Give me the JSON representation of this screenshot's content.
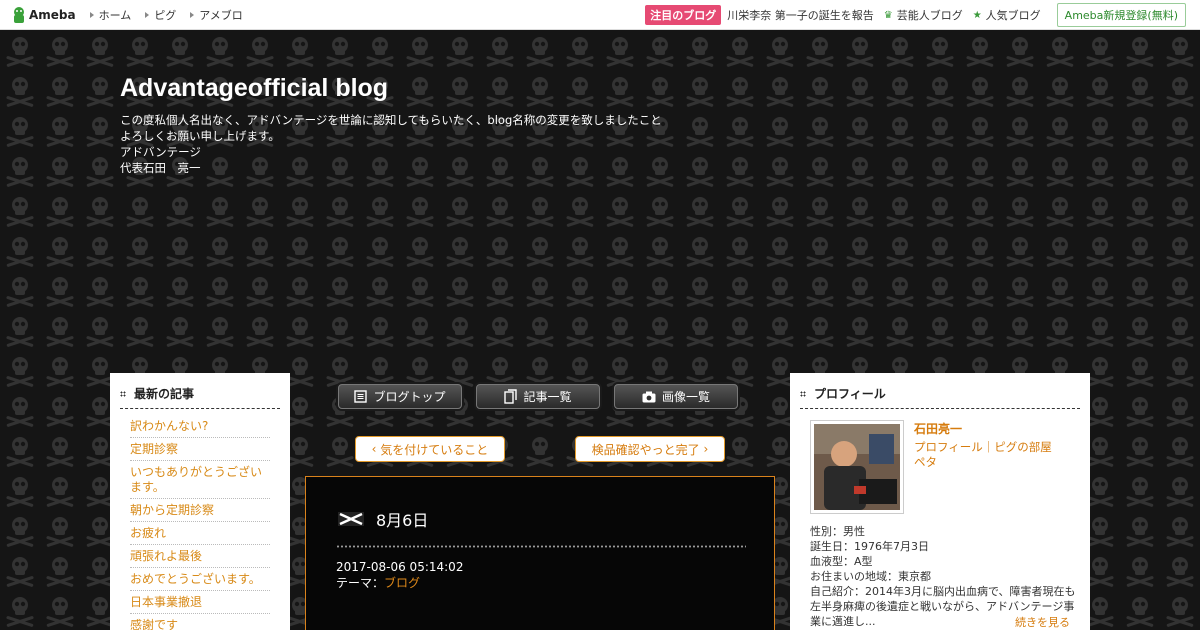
{
  "topbar": {
    "logo": "Ameba",
    "nav": [
      "ホーム",
      "ピグ",
      "アメブロ"
    ],
    "badge": "注目のブログ",
    "featured": "川栄李奈 第一子の誕生を報告",
    "celeb": "芸能人ブログ",
    "popular": "人気ブログ",
    "register": "Ameba新規登録(無料)"
  },
  "header": {
    "title": "Advantageofficial blog",
    "desc": [
      "この度私個人名出なく、アドバンテージを世論に認知してもらいたく、blog名称の変更を致しましたこと",
      "よろしくお願い申し上げます。",
      "アドバンテージ",
      "代表石田　亮一"
    ]
  },
  "sidebar": {
    "title": "最新の記事",
    "items": [
      "訳わかんない?",
      "定期診察",
      "いつもありがとうございます。",
      "朝から定期診察",
      "お疲れ",
      "頑張れよ最後",
      "おめでとうございます。",
      "日本事業撤退",
      "感謝です"
    ]
  },
  "nav_buttons": {
    "top": "ブログトップ",
    "list": "記事一覧",
    "images": "画像一覧"
  },
  "pager": {
    "prev": "気を付けていること",
    "next": "検品確認やっと完了"
  },
  "article": {
    "title": "8月6日",
    "date": "2017-08-06 05:14:02",
    "theme_label": "テーマ：",
    "theme": "ブログ"
  },
  "profile": {
    "title": "プロフィール",
    "name": "石田亮一",
    "links": "プロフィール｜ピグの部屋",
    "peta": "ペタ",
    "info": [
      "性別：男性",
      "誕生日：1976年7月3日",
      "血液型：A型",
      "お住まいの地域：東京都",
      "自己紹介：2014年3月に脳内出血病で、障害者現在も左半身麻痺の後遺症と戦いながら、アドバンテージ事業に邁進し..."
    ],
    "more": "続きを見る"
  },
  "colors": {
    "accent": "#d67c0e",
    "badge": "#e64a73",
    "green": "#2d8a2d"
  }
}
